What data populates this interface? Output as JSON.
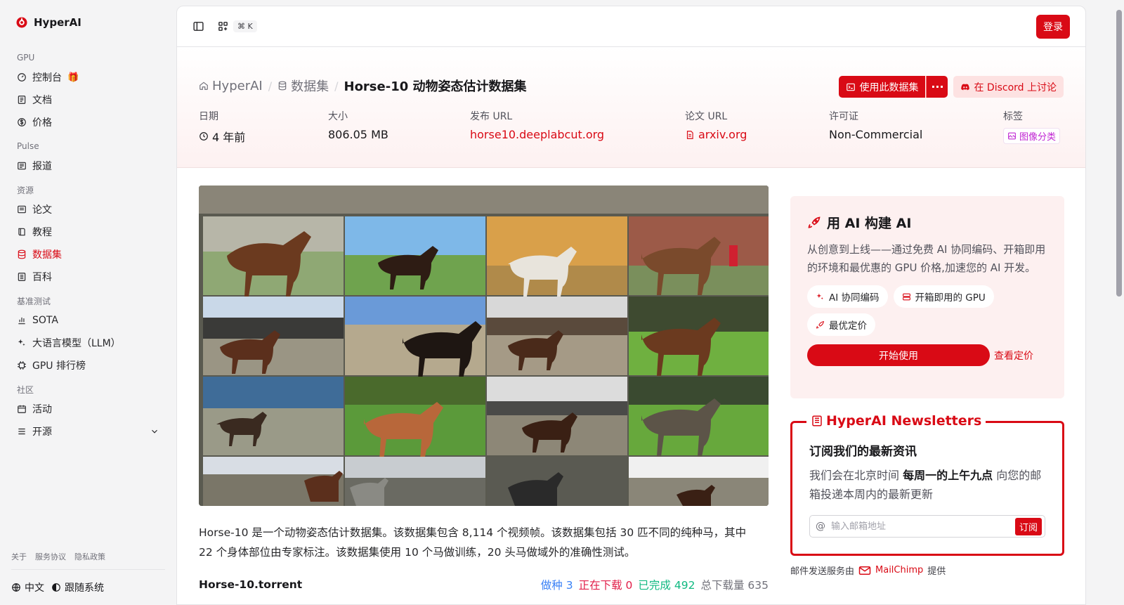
{
  "brand": {
    "name": "HyperAI"
  },
  "sidebar": {
    "groups": [
      {
        "label": "GPU",
        "items": [
          {
            "label": "控制台",
            "icon": "dashboard-icon"
          },
          {
            "label": "文档",
            "icon": "document-icon"
          },
          {
            "label": "价格",
            "icon": "dollar-icon"
          }
        ]
      },
      {
        "label": "Pulse",
        "items": [
          {
            "label": "报道",
            "icon": "news-icon"
          }
        ]
      },
      {
        "label": "资源",
        "items": [
          {
            "label": "论文",
            "icon": "paper-icon"
          },
          {
            "label": "教程",
            "icon": "book-icon"
          },
          {
            "label": "数据集",
            "icon": "database-icon",
            "active": true
          },
          {
            "label": "百科",
            "icon": "wiki-icon"
          }
        ]
      },
      {
        "label": "基准测试",
        "items": [
          {
            "label": "SOTA",
            "icon": "bar-chart-icon"
          },
          {
            "label": "大语言模型（LLM）",
            "icon": "sparkle-icon"
          },
          {
            "label": "GPU 排行榜",
            "icon": "chip-icon"
          }
        ]
      },
      {
        "label": "社区",
        "items": [
          {
            "label": "活动",
            "icon": "calendar-icon"
          },
          {
            "label": "开源",
            "icon": "menu-icon"
          }
        ]
      }
    ],
    "footer_links": [
      "关于",
      "服务协议",
      "隐私政策"
    ],
    "language": "中文",
    "theme": "跟随系统"
  },
  "topbar": {
    "shortcut": "⌘ K",
    "login": "登录"
  },
  "breadcrumb": {
    "home": "HyperAI",
    "section": "数据集",
    "current": "Horse-10 动物姿态估计数据集"
  },
  "actions": {
    "use_dataset": "使用此数据集",
    "discord": "在 Discord 上讨论"
  },
  "meta": {
    "date": {
      "label": "日期",
      "value": "4 年前"
    },
    "size": {
      "label": "大小",
      "value": "806.05 MB"
    },
    "release_url": {
      "label": "发布 URL",
      "value": "horse10.deeplabcut.org"
    },
    "paper_url": {
      "label": "论文 URL",
      "value": "arxiv.org"
    },
    "license": {
      "label": "许可证",
      "value": "Non-Commercial"
    },
    "tags": {
      "label": "标签",
      "value": "图像分类"
    }
  },
  "description": "Horse-10 是一个动物姿态估计数据集。该数据集包含 8,114 个视频帧。该数据集包括 30 匹不同的纯种马，其中 22 个身体部位由专家标注。该数据集使用 10 个马做训练，20 头马做域外的准确性测试。",
  "torrent": {
    "name": "Horse-10.torrent",
    "seed_label": "做种",
    "seed": "3",
    "downloading_label": "正在下载",
    "downloading": "0",
    "completed_label": "已完成",
    "completed": "492",
    "total_label": "总下载量",
    "total": "635"
  },
  "promo": {
    "title": "用 AI 构建 AI",
    "text": "从创意到上线——通过免费 AI 协同编码、开箱即用的环境和最优惠的 GPU 价格,加速您的 AI 开发。",
    "chips": [
      "AI 协同编码",
      "开箱即用的 GPU",
      "最优定价"
    ],
    "start": "开始使用",
    "pricing": "查看定价"
  },
  "newsletter": {
    "legend": "HyperAI Newsletters",
    "title": "订阅我们的最新资讯",
    "text_before": "我们会在北京时间 ",
    "text_bold": "每周一的上午九点",
    "text_after": " 向您的邮箱投递本周内的最新更新",
    "placeholder": "输入邮箱地址",
    "subscribe": "订阅",
    "provider_before": "邮件发送服务由",
    "provider": "MailChimp",
    "provider_after": "提供"
  },
  "colors": {
    "accent": "#d90a15",
    "tag": "#c026d3",
    "seed": "#3b82f6",
    "downloading": "#e11d48",
    "completed": "#10b981"
  }
}
